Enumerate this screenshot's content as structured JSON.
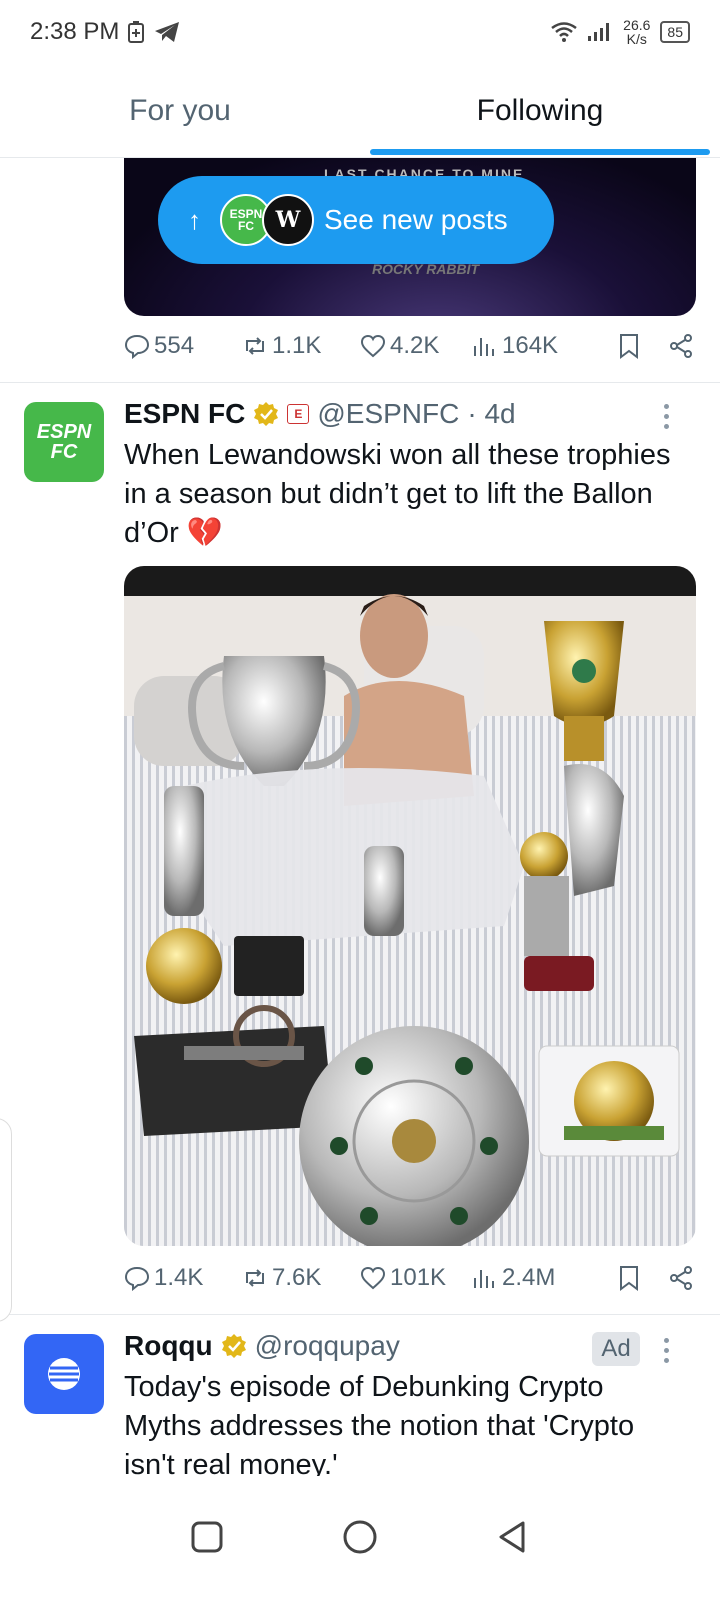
{
  "status_bar": {
    "time": "2:38 PM",
    "net_speed_value": "26.6",
    "net_speed_unit": "K/s",
    "battery": "85"
  },
  "tabs": [
    {
      "label": "For you",
      "active": false
    },
    {
      "label": "Following",
      "active": true
    }
  ],
  "previous_post": {
    "media_text_top": "LAST CHANCE TO MINE",
    "media_text_brand": "ROCKY RABBIT",
    "metrics": {
      "replies": "554",
      "reposts": "1.1K",
      "likes": "4.2K",
      "views": "164K"
    }
  },
  "new_posts_pill": {
    "label": "See new posts",
    "avatar_1_text": "ESPN FC",
    "avatar_2_text": "W"
  },
  "tweet": {
    "author_name": "ESPN FC",
    "avatar_text": "ESPN FC",
    "handle": "@ESPNFC",
    "time": "· 4d",
    "text": "When Lewandowski won all these trophies in a season but didn’t get to lift the Ballon d’Or 💔",
    "metrics": {
      "replies": "1.4K",
      "reposts": "7.6K",
      "likes": "101K",
      "views": "2.4M"
    }
  },
  "ad_tweet": {
    "author_name": "Roqqu",
    "handle": "@roqqupay",
    "badge": "Ad",
    "text": "Today's episode of Debunking Crypto Myths addresses the notion that 'Crypto isn't real money.'"
  },
  "colors": {
    "accent": "#1d9bf0",
    "espn_green": "#46b84a",
    "roqqu_blue": "#3366f5",
    "verified_gold": "#e2b719"
  },
  "icons": [
    "reply-icon",
    "repost-icon",
    "like-icon",
    "views-icon",
    "bookmark-icon",
    "share-icon",
    "verified-icon",
    "more-icon",
    "nav-recents-icon",
    "nav-home-icon",
    "nav-back-icon"
  ]
}
